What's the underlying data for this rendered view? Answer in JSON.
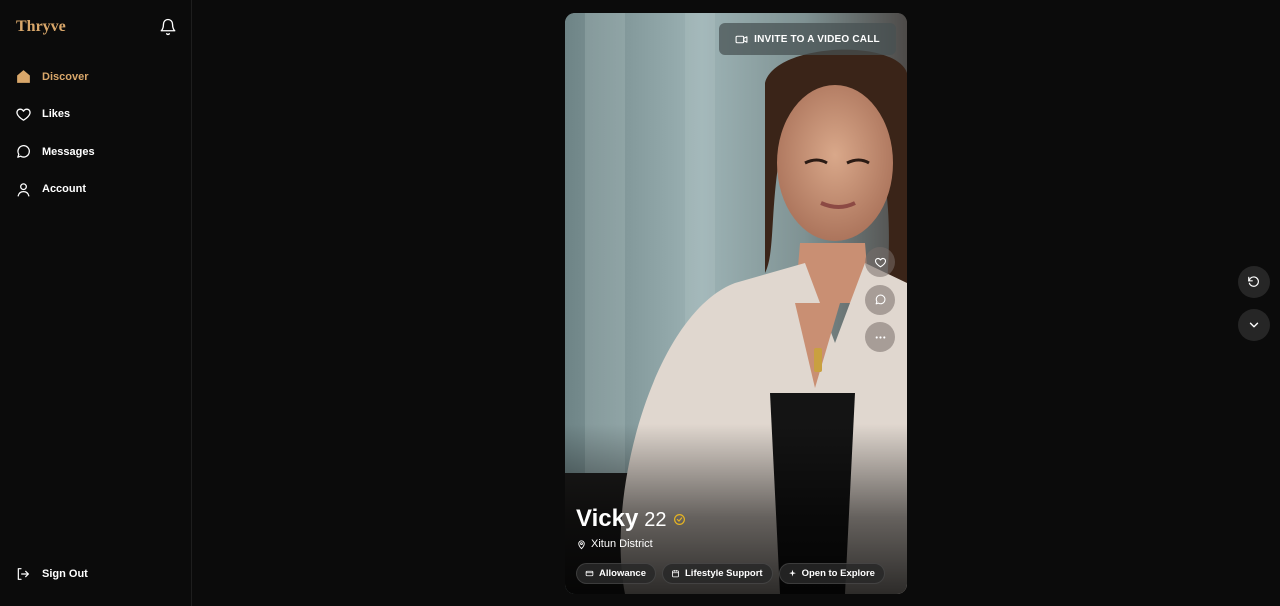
{
  "app": {
    "brand": "Thryve"
  },
  "sidebar": {
    "items": [
      {
        "label": "Discover",
        "icon": "home-icon",
        "active": true
      },
      {
        "label": "Likes",
        "icon": "heart-icon",
        "active": false
      },
      {
        "label": "Messages",
        "icon": "chat-bubble-icon",
        "active": false
      },
      {
        "label": "Account",
        "icon": "user-icon",
        "active": false
      }
    ],
    "signout_label": "Sign Out"
  },
  "profile": {
    "video_call_label": "INVITE TO A VIDEO CALL",
    "name": "Vicky",
    "age": "22",
    "location": "Xitun District",
    "tags": [
      {
        "label": "Allowance",
        "icon": "wallet-icon"
      },
      {
        "label": "Lifestyle Support",
        "icon": "calendar-icon"
      },
      {
        "label": "Open to Explore",
        "icon": "sparkle-icon"
      }
    ]
  },
  "colors": {
    "accent": "#d9a76a",
    "background": "#0b0b0b",
    "verified": "#e6b422"
  }
}
